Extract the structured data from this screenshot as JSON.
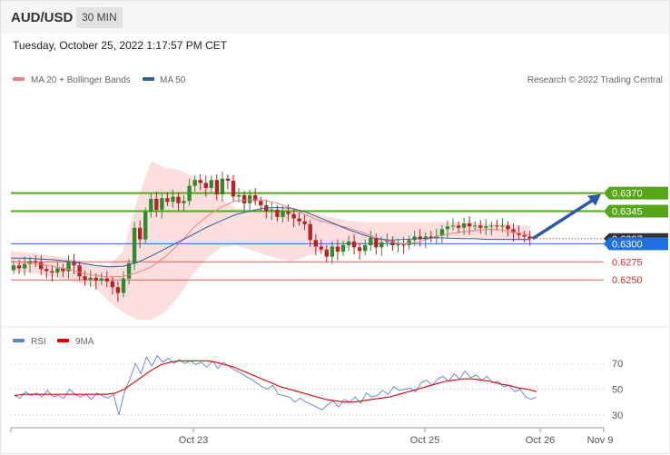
{
  "header": {
    "symbol": "AUD/USD",
    "timeframe": "30 MIN"
  },
  "date_label": "Tuesday, October 25, 2022 1:17:57 PM CET",
  "legend": {
    "ma20_label": "MA 20 + Bollinger Bands",
    "ma50_label": "MA 50",
    "copyright": "Research © 2022 Trading Central",
    "rsi_label": "RSI",
    "rsi_ma_label": "9MA"
  },
  "colors": {
    "support_resistance": "#55a618",
    "pivot": "#1e6fe0",
    "ma20": "#f08080",
    "ma50": "#2f5f9f",
    "rsi": "#5a82d8",
    "rsi_ma": "#e00000",
    "bull": "#2e8b2e",
    "bear": "#b82222"
  },
  "chart_data": [
    {
      "type": "candlestick",
      "levels": [
        {
          "label": "0.6370",
          "value": 0.637,
          "kind": "resistance"
        },
        {
          "label": "0.6345",
          "value": 0.6345,
          "kind": "resistance"
        },
        {
          "label": "0.6300",
          "value": 0.63,
          "kind": "pivot"
        },
        {
          "label": "0.6275",
          "value": 0.6275,
          "kind": "support"
        },
        {
          "label": "0.6250",
          "value": 0.625,
          "kind": "support"
        }
      ],
      "last_price": {
        "label": "0.6307",
        "value": 0.6307
      },
      "ylim": [
        0.619,
        0.65
      ],
      "x_ticks": [
        "Oct 23",
        "Oct 25",
        "Oct 26",
        "Nov 9"
      ],
      "closes": [
        0.627,
        0.6266,
        0.6272,
        0.6276,
        0.6274,
        0.6265,
        0.6262,
        0.626,
        0.6266,
        0.6262,
        0.6276,
        0.627,
        0.6255,
        0.625,
        0.6253,
        0.6249,
        0.6252,
        0.6248,
        0.624,
        0.6232,
        0.6252,
        0.6273,
        0.6322,
        0.6306,
        0.6344,
        0.6362,
        0.6347,
        0.6363,
        0.6358,
        0.6365,
        0.6356,
        0.6359,
        0.638,
        0.6388,
        0.6384,
        0.6377,
        0.6388,
        0.6368,
        0.639,
        0.6387,
        0.6365,
        0.6367,
        0.6356,
        0.6367,
        0.6359,
        0.6353,
        0.6345,
        0.6347,
        0.6337,
        0.6344,
        0.6341,
        0.6335,
        0.6331,
        0.6327,
        0.6305,
        0.6296,
        0.6292,
        0.6282,
        0.6296,
        0.6289,
        0.6298,
        0.6303,
        0.6295,
        0.629,
        0.6298,
        0.6308,
        0.6295,
        0.6302,
        0.6304,
        0.6298,
        0.6299,
        0.6298,
        0.6305,
        0.631,
        0.6306,
        0.631,
        0.6308,
        0.6311,
        0.632,
        0.6324,
        0.6325,
        0.6322,
        0.6328,
        0.6324,
        0.6325,
        0.6322,
        0.6324,
        0.6325,
        0.6324,
        0.6325,
        0.632,
        0.6315,
        0.6312,
        0.631,
        0.6307
      ],
      "ma20": [
        0.6276,
        0.6274,
        0.6272,
        0.6269,
        0.6265,
        0.626,
        0.6256,
        0.6254,
        0.6255,
        0.626,
        0.6268,
        0.6282,
        0.63,
        0.6322,
        0.6338,
        0.6351,
        0.6359,
        0.6361,
        0.636,
        0.6356,
        0.6349,
        0.634,
        0.6332,
        0.6327,
        0.6322,
        0.6316,
        0.6309,
        0.6303,
        0.63,
        0.6302,
        0.6308,
        0.6313,
        0.6316,
        0.6318,
        0.632,
        0.6319,
        0.6315,
        0.6312
      ],
      "ma50": [
        0.628,
        0.628,
        0.6279,
        0.6278,
        0.6276,
        0.6273,
        0.627,
        0.6268,
        0.6269,
        0.6274,
        0.6283,
        0.6293,
        0.6303,
        0.6313,
        0.6323,
        0.6332,
        0.634,
        0.6345,
        0.6349,
        0.635,
        0.6349,
        0.6344,
        0.6336,
        0.6328,
        0.632,
        0.6313,
        0.6307,
        0.6305,
        0.6306,
        0.6307,
        0.6308,
        0.6308,
        0.6307,
        0.6307,
        0.6306,
        0.6306,
        0.6306,
        0.6306
      ],
      "bb_upper": [
        0.629,
        0.6288,
        0.6286,
        0.6283,
        0.628,
        0.6275,
        0.627,
        0.627,
        0.629,
        0.636,
        0.6414,
        0.6405,
        0.6402,
        0.6393,
        0.638,
        0.6362,
        0.635,
        0.6345,
        0.6348,
        0.6348,
        0.635,
        0.6345,
        0.634,
        0.6336,
        0.6332,
        0.633,
        0.633,
        0.633,
        0.633,
        0.633,
        0.633,
        0.633,
        0.633,
        0.633,
        0.6328,
        0.6328,
        0.6326,
        0.6324
      ],
      "bb_lower": [
        0.6262,
        0.626,
        0.6258,
        0.6254,
        0.625,
        0.6245,
        0.624,
        0.622,
        0.6205,
        0.6195,
        0.6195,
        0.6205,
        0.6228,
        0.6258,
        0.628,
        0.6295,
        0.6298,
        0.6292,
        0.6285,
        0.628,
        0.6276,
        0.6282,
        0.6289,
        0.6292,
        0.6294,
        0.6298,
        0.63,
        0.6305,
        0.6308,
        0.631,
        0.631,
        0.631,
        0.6308,
        0.6308,
        0.6306,
        0.6306,
        0.6304,
        0.6302
      ],
      "target": {
        "from": 0.6307,
        "to": 0.637
      }
    },
    {
      "type": "line",
      "series": [
        {
          "name": "RSI",
          "values": [
            45,
            43,
            48,
            45,
            47,
            44,
            49,
            44,
            45,
            43,
            50,
            46,
            44,
            46,
            42,
            47,
            45,
            43,
            46,
            30,
            48,
            58,
            70,
            62,
            75,
            68,
            76,
            71,
            74,
            70,
            73,
            70,
            72,
            69,
            71,
            67,
            72,
            66,
            71,
            68,
            65,
            63,
            60,
            58,
            55,
            52,
            50,
            53,
            46,
            45,
            44,
            40,
            43,
            40,
            38,
            36,
            34,
            38,
            41,
            36,
            42,
            40,
            44,
            39,
            47,
            44,
            45,
            49,
            46,
            52,
            49,
            50,
            51,
            48,
            55,
            57,
            53,
            58,
            60,
            56,
            62,
            58,
            64,
            59,
            61,
            57,
            60,
            55,
            56,
            52,
            53,
            48,
            50,
            44,
            42,
            44
          ]
        },
        {
          "name": "9MA",
          "values": [
            45,
            46,
            46,
            46,
            46,
            46,
            46,
            46,
            46,
            46,
            46,
            47,
            50,
            55,
            60,
            65,
            69,
            71,
            72,
            72,
            72,
            72,
            71,
            69,
            67,
            64,
            61,
            58,
            55,
            52,
            50,
            48,
            46,
            44,
            42,
            41,
            40,
            40,
            41,
            42,
            43,
            44,
            46,
            48,
            50,
            52,
            54,
            56,
            57,
            58,
            58,
            57,
            56,
            54,
            53,
            51,
            50,
            48
          ]
        }
      ],
      "y_ticks": [
        70,
        50,
        30
      ],
      "ylim": [
        20,
        80
      ]
    }
  ]
}
